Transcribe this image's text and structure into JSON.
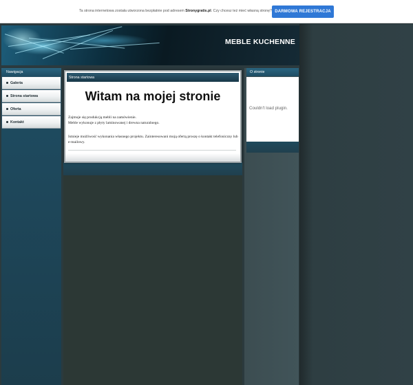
{
  "promo": {
    "text_before": "Ta strona internetowa została utworzona bezpłatnie pod adresem ",
    "site_name": "Stronygratis.pl",
    "text_after": ". Czy chcesz też mieć własną stronę?",
    "button_label": "DARMOWA REJESTRACJA"
  },
  "header": {
    "title": "MEBLE KUCHENNE"
  },
  "navigation": {
    "heading": "Nawigacja",
    "items": [
      {
        "label": "Galeria"
      },
      {
        "label": "Strona startowa"
      },
      {
        "label": "Oferta"
      },
      {
        "label": "Kontakt"
      }
    ]
  },
  "main": {
    "tab_label": "Strona startowa",
    "title": "Witam na mojej stronie",
    "paragraph1_line1": "Zajmuje się produkcją mebli na zamówienie.",
    "paragraph1_line2": "Meble wykonuje z płyty laminowanej i drewna naturalnego.",
    "paragraph2": "Istnieje możliwość wykonania własnego projektu. Zainteresowani moją ofertą proszę o kontakt telefoniczny lub e-mailowy."
  },
  "about": {
    "heading": "O stronie",
    "message": "Couldn't load plugin."
  },
  "colors": {
    "button": "#2f78d6",
    "nav_panel": "#1f4d63",
    "page_background": "#2b3a3e"
  }
}
